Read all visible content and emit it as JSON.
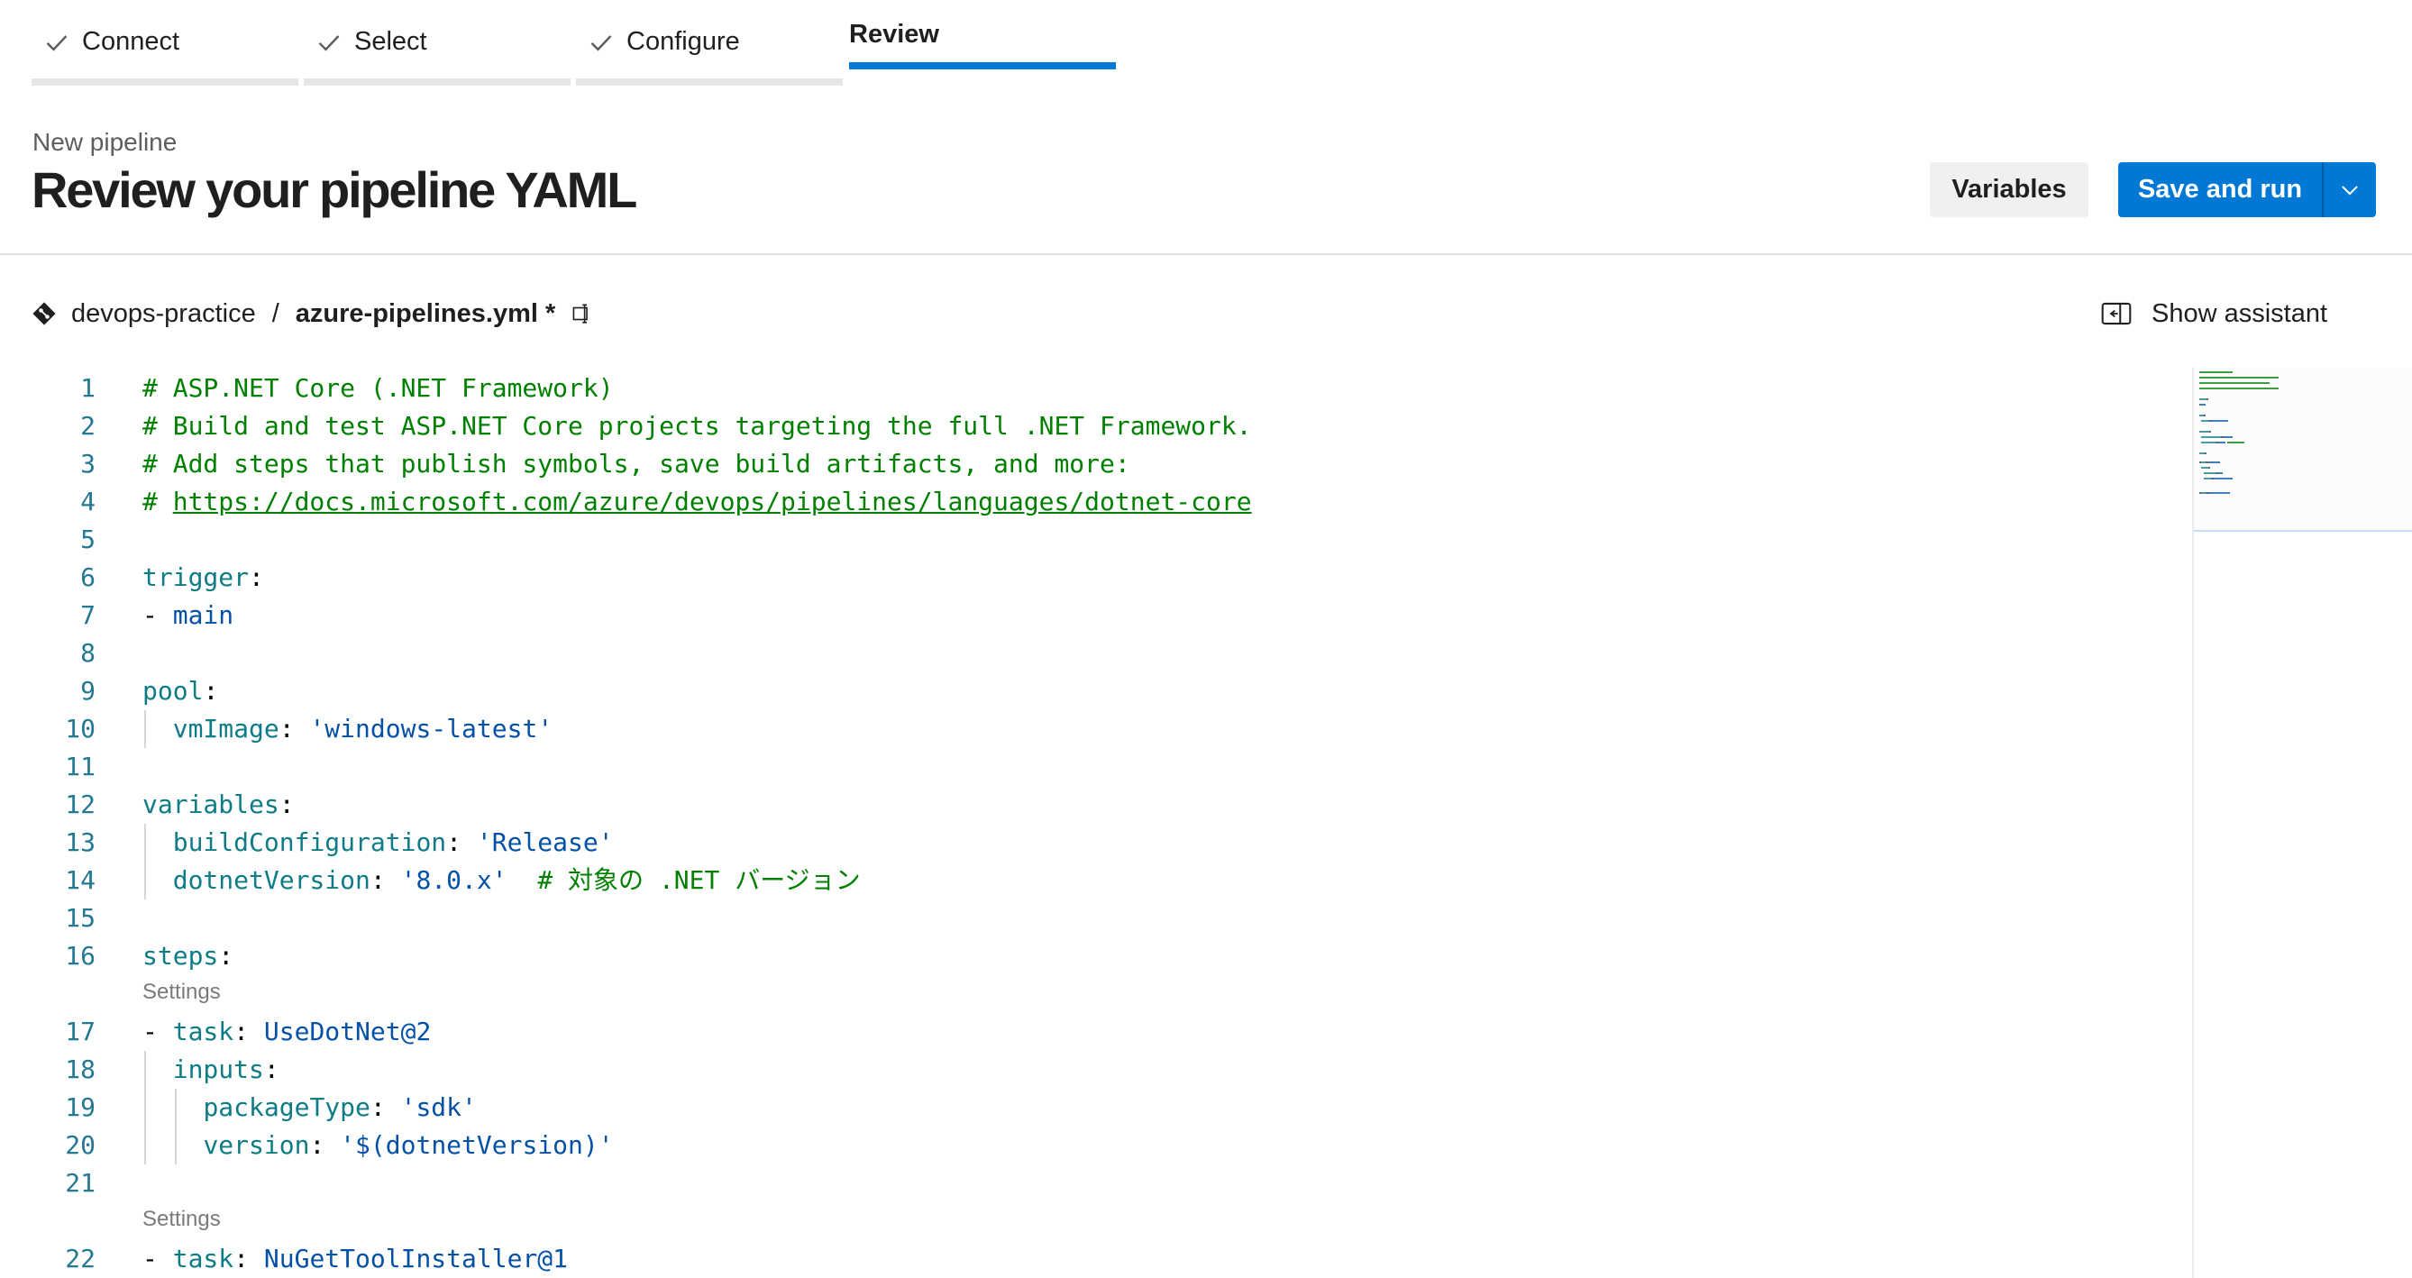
{
  "steps": [
    {
      "label": "Connect",
      "state": "done"
    },
    {
      "label": "Select",
      "state": "done"
    },
    {
      "label": "Configure",
      "state": "done"
    },
    {
      "label": "Review",
      "state": "active"
    }
  ],
  "header": {
    "subtitle": "New pipeline",
    "title": "Review your pipeline YAML",
    "variables_label": "Variables",
    "save_run_label": "Save and run"
  },
  "path": {
    "repo": "devops-practice",
    "separator": "/",
    "file": "azure-pipelines.yml *"
  },
  "assistant": {
    "label": "Show assistant"
  },
  "editor": {
    "lens_label": "Settings",
    "lines": [
      {
        "n": "1",
        "tokens": [
          [
            "comment",
            "# ASP.NET Core (.NET Framework)"
          ]
        ]
      },
      {
        "n": "2",
        "tokens": [
          [
            "comment",
            "# Build and test ASP.NET Core projects targeting the full .NET Framework."
          ]
        ]
      },
      {
        "n": "3",
        "tokens": [
          [
            "comment",
            "# Add steps that publish symbols, save build artifacts, and more:"
          ]
        ]
      },
      {
        "n": "4",
        "tokens": [
          [
            "comment",
            "# "
          ],
          [
            "link",
            "https://docs.microsoft.com/azure/devops/pipelines/languages/dotnet-core"
          ]
        ]
      },
      {
        "n": "5",
        "tokens": []
      },
      {
        "n": "6",
        "tokens": [
          [
            "key",
            "trigger"
          ],
          [
            "plain",
            ":"
          ]
        ]
      },
      {
        "n": "7",
        "tokens": [
          [
            "plain",
            "- "
          ],
          [
            "str",
            "main"
          ]
        ]
      },
      {
        "n": "8",
        "tokens": []
      },
      {
        "n": "9",
        "tokens": [
          [
            "key",
            "pool"
          ],
          [
            "plain",
            ":"
          ]
        ]
      },
      {
        "n": "10",
        "tokens": [
          [
            "plain",
            "  "
          ],
          [
            "key",
            "vmImage"
          ],
          [
            "plain",
            ": "
          ],
          [
            "str",
            "'windows-latest'"
          ]
        ]
      },
      {
        "n": "11",
        "tokens": []
      },
      {
        "n": "12",
        "tokens": [
          [
            "key",
            "variables"
          ],
          [
            "plain",
            ":"
          ]
        ]
      },
      {
        "n": "13",
        "tokens": [
          [
            "plain",
            "  "
          ],
          [
            "key",
            "buildConfiguration"
          ],
          [
            "plain",
            ": "
          ],
          [
            "str",
            "'Release'"
          ]
        ]
      },
      {
        "n": "14",
        "tokens": [
          [
            "plain",
            "  "
          ],
          [
            "key",
            "dotnetVersion"
          ],
          [
            "plain",
            ": "
          ],
          [
            "str",
            "'8.0.x'"
          ],
          [
            "plain",
            "  "
          ],
          [
            "comment",
            "# 対象の .NET バージョン"
          ]
        ]
      },
      {
        "n": "15",
        "tokens": []
      },
      {
        "n": "16",
        "tokens": [
          [
            "key",
            "steps"
          ],
          [
            "plain",
            ":"
          ]
        ]
      },
      {
        "n": "17",
        "lens": true,
        "tokens": [
          [
            "plain",
            "- "
          ],
          [
            "key",
            "task"
          ],
          [
            "plain",
            ": "
          ],
          [
            "str",
            "UseDotNet@2"
          ]
        ]
      },
      {
        "n": "18",
        "tokens": [
          [
            "plain",
            "  "
          ],
          [
            "key",
            "inputs"
          ],
          [
            "plain",
            ":"
          ]
        ]
      },
      {
        "n": "19",
        "tokens": [
          [
            "plain",
            "    "
          ],
          [
            "key",
            "packageType"
          ],
          [
            "plain",
            ": "
          ],
          [
            "str",
            "'sdk'"
          ]
        ]
      },
      {
        "n": "20",
        "tokens": [
          [
            "plain",
            "    "
          ],
          [
            "key",
            "version"
          ],
          [
            "plain",
            ": "
          ],
          [
            "str",
            "'$(dotnetVersion)'"
          ]
        ]
      },
      {
        "n": "21",
        "tokens": []
      },
      {
        "n": "22",
        "lens": true,
        "tokens": [
          [
            "plain",
            "- "
          ],
          [
            "key",
            "task"
          ],
          [
            "plain",
            ": "
          ],
          [
            "str",
            "NuGetToolInstaller@1"
          ]
        ]
      }
    ]
  },
  "colors": {
    "accent": "#0078d4",
    "comment": "#008000",
    "key": "#0e7c86",
    "string": "#0451a5",
    "line_number": "#237893"
  }
}
